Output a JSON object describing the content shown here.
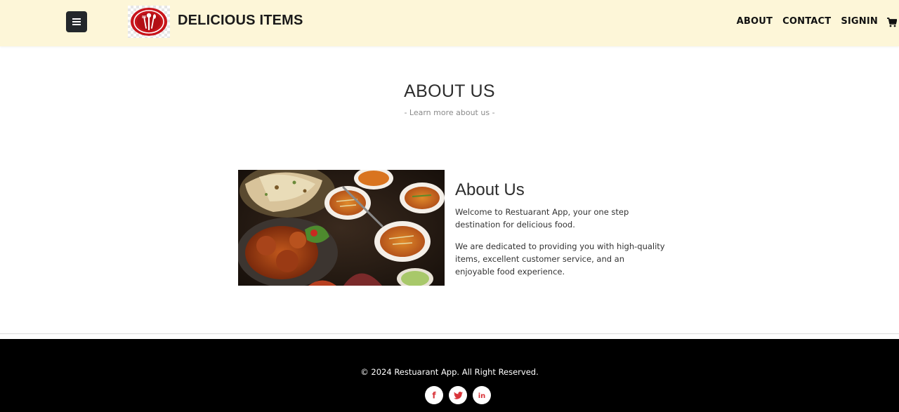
{
  "brand": {
    "name": "DELICIOUS ITEMS"
  },
  "nav": {
    "menu_icon": "bars-icon",
    "links": [
      {
        "label": "ABOUT"
      },
      {
        "label": "CONTACT"
      },
      {
        "label": "SIGNIN"
      }
    ],
    "cart_icon": "shopping-cart-icon"
  },
  "section": {
    "title": "ABOUT US",
    "subtitle": "- Learn more about us -"
  },
  "about": {
    "image_alt": "assorted dishes",
    "heading": "About Us",
    "paragraph1": "Welcome to Restuarant App, your one step destination for delicious food.",
    "paragraph2": "We are dedicated to providing you with high-quality items, excellent customer service, and an enjoyable food experience."
  },
  "footer": {
    "copyright": "© 2024 Restuarant App. All Right Reserved.",
    "socials": [
      {
        "icon": "facebook-icon",
        "glyph": "f"
      },
      {
        "icon": "twitter-icon"
      },
      {
        "icon": "linkedin-icon",
        "glyph": "in"
      }
    ]
  },
  "colors": {
    "navbar_bg": "#fdf6d8",
    "footer_bg": "#000000",
    "social_icon": "#d9343a",
    "logo_red": "#c8141b"
  }
}
